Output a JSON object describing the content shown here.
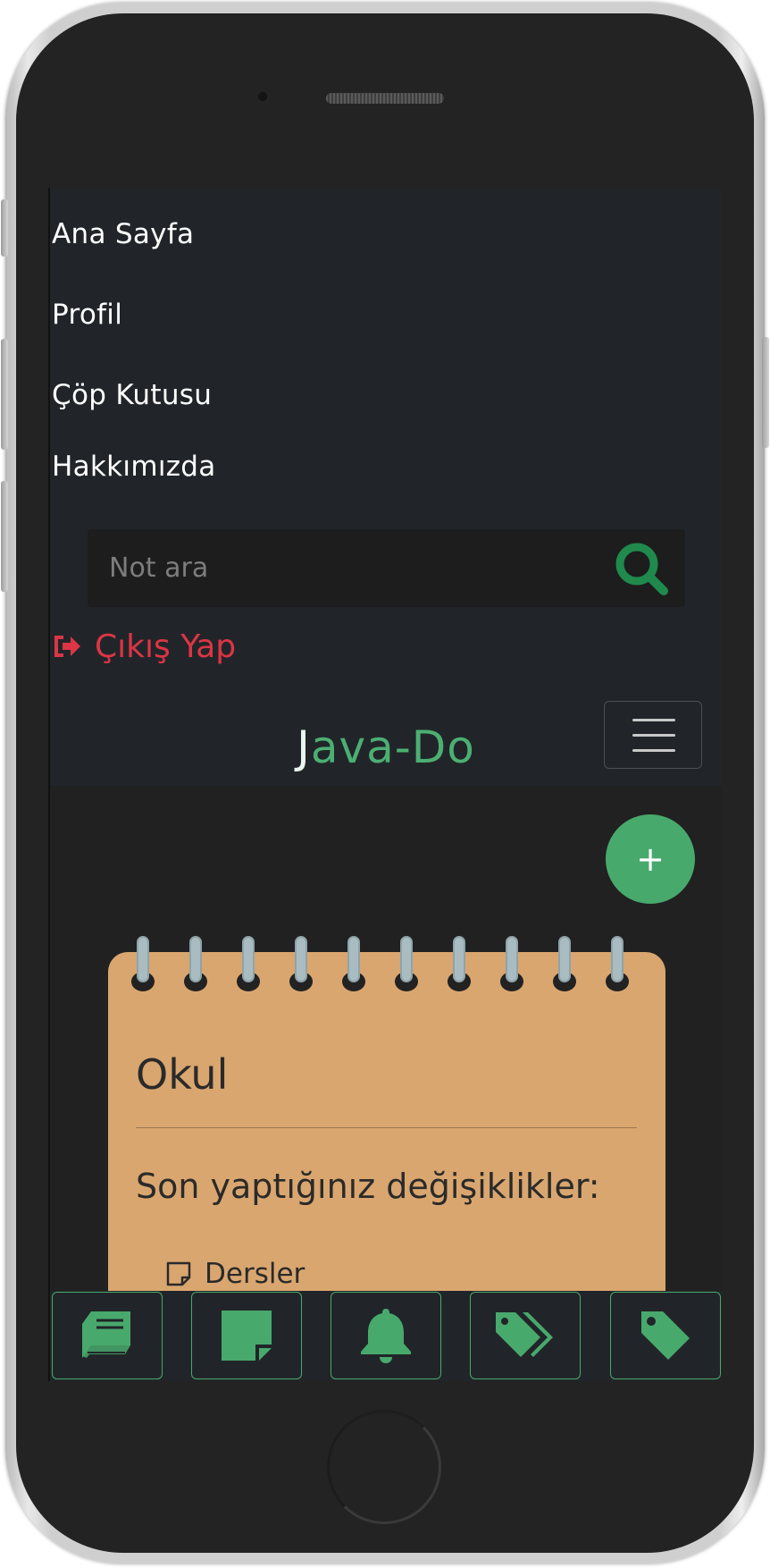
{
  "app": {
    "brand": "Java-Do",
    "accent_color": "#48a96c",
    "danger_color": "#dc3545",
    "nav_bg_color": "#212529"
  },
  "nav": {
    "items": [
      {
        "label": "Ana Sayfa"
      },
      {
        "label": "Profil"
      },
      {
        "label": "Çöp Kutusu"
      },
      {
        "label": "Hakkımızda"
      }
    ],
    "search": {
      "placeholder": "Not ara",
      "value": ""
    },
    "logout_label": "Çıkış Yap"
  },
  "fab": {
    "label": "+"
  },
  "note": {
    "title": "Okul",
    "subtitle": "Son yaptığınız değişiklikler:",
    "items": [
      {
        "label": "Dersler",
        "icon": "sticky-note-icon"
      }
    ],
    "color": "#d9a66f"
  },
  "bottom_tabs": [
    {
      "icon": "book-icon"
    },
    {
      "icon": "sticky-note-icon"
    },
    {
      "icon": "bell-icon"
    },
    {
      "icon": "tags-icon"
    },
    {
      "icon": "tag-icon"
    }
  ]
}
